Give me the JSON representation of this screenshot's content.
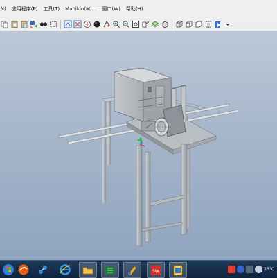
{
  "menubar": {
    "items": [
      {
        "label": "(N)"
      },
      {
        "label": "应用程序(P)"
      },
      {
        "label": "工具(T)"
      },
      {
        "label": "Manikin(M)..."
      },
      {
        "label": "窗口(W)"
      },
      {
        "label": "帮助(H)"
      }
    ]
  },
  "toolbar": {
    "icons": [
      "copy-icon",
      "paste-icon",
      "paste-special-icon",
      "regenerate-icon",
      "find-icon",
      "select-box-icon",
      "view-refit-icon",
      "orient-icon",
      "display-style-icon",
      "spin-center-icon",
      "zoom-in-icon",
      "zoom-out-icon",
      "refit-icon",
      "saved-views-icon",
      "layers-icon",
      "shaded-icon",
      "wireframe-icon",
      "hidden-line-icon",
      "no-hidden-icon",
      "datum-icon",
      "model-tree-icon"
    ]
  },
  "taskbar": {
    "apps": [
      "start-icon",
      "browser-360-icon",
      "network-icon",
      "ie-icon",
      "folder-icon",
      "spreadsheet-icon",
      "paint-icon",
      "solidworks-icon",
      "notes-icon"
    ],
    "temperature": "23°C"
  },
  "colors": {
    "accent": "#1e3a5f",
    "viewport_top": "#bcc8d8",
    "viewport_bottom": "#8fa4bf",
    "model_gray": "#a8adb3"
  }
}
